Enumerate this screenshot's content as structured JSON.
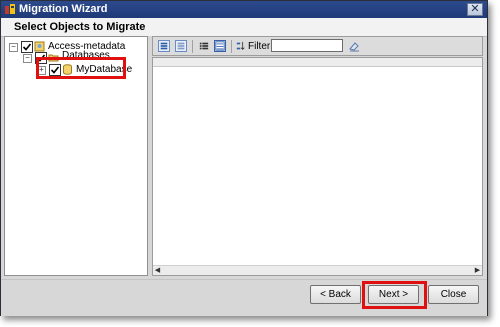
{
  "window": {
    "title": "Migration Wizard",
    "close_glyph": "✕"
  },
  "header": {
    "title": "Select Objects to Migrate"
  },
  "tree": {
    "nodes": [
      {
        "label": "Access-metadata",
        "checked": true,
        "expander": "−",
        "icon": "metadata-icon"
      },
      {
        "label": "Databases",
        "checked": true,
        "expander": "−",
        "icon": "folder-icon"
      },
      {
        "label": "MyDatabase",
        "checked": true,
        "expander": "+",
        "icon": "database-icon"
      }
    ]
  },
  "toolbar": {
    "filter_label": "Filter:",
    "filter_value": "",
    "buttons": [
      "select-all-icon",
      "deselect-all-icon",
      "list-view-icon",
      "details-view-icon",
      "sort-icon",
      "clear-filter-icon"
    ]
  },
  "footer": {
    "back_label": "< Back",
    "next_label": "Next >",
    "close_label": "Close"
  },
  "colors": {
    "title_bar": "#1f3a78",
    "highlight": "#e01010"
  }
}
